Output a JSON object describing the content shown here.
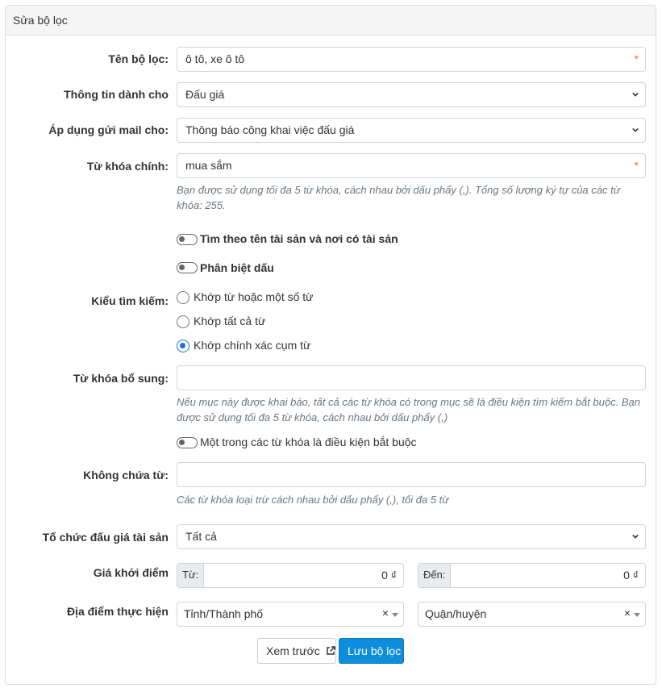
{
  "panel": {
    "title": "Sửa bộ lọc"
  },
  "fields": {
    "filter_name": {
      "label": "Tên bộ lọc:",
      "value": "ô tô, xe ô tô",
      "required": "*"
    },
    "info_for": {
      "label": "Thông tin dành cho",
      "value": "Đấu giá"
    },
    "mail_apply": {
      "label": "Áp dụng gửi mail cho:",
      "value": "Thông báo công khai việc đấu giá"
    },
    "main_keyword": {
      "label": "Từ khóa chính:",
      "value": "mua sắm",
      "required": "*",
      "help": "Bạn được sử dụng tối đa 5 từ khóa, cách nhau bởi dấu phẩy (,). Tổng số lượng ký tự của các từ khóa: 255."
    },
    "toggle_name_place": {
      "label": "Tìm theo tên tài sản và nơi có tài sản",
      "checked": false
    },
    "toggle_accent": {
      "label": "Phân biệt dấu",
      "checked": false
    },
    "search_type": {
      "label": "Kiểu tìm kiếm:",
      "options": [
        "Khớp từ hoặc một số từ",
        "Khớp tất cả từ",
        "Khớp chính xác cụm từ"
      ],
      "selected": "Khớp chính xác cụm từ"
    },
    "extra_keyword": {
      "label": "Từ khóa bổ sung:",
      "value": "",
      "help": "Nếu mục này được khai báo, tất cả các từ khóa có trong mục sẽ là điều kiện tìm kiếm bắt buộc. Bạn được sử dụng tối đa 5 từ khóa, cách nhau bởi dấu phẩy (,)",
      "toggle_label": "Một trong các từ khóa là điều kiện bắt buộc",
      "toggle_checked": false
    },
    "exclude": {
      "label": "Không chứa từ:",
      "value": "",
      "help": "Các từ khóa loại trừ cách nhau bởi dấu phẩy (,), tối đa 5 từ"
    },
    "organizer": {
      "label": "Tổ chức đấu giá tài sản",
      "value": "Tất cả"
    },
    "start_price": {
      "label": "Giá khởi điểm",
      "from_label": "Từ:",
      "from_value": "0 ₫",
      "to_label": "Đến:",
      "to_value": "0 ₫"
    },
    "location": {
      "label": "Địa điểm thực hiện",
      "province": "Tỉnh/Thành phố",
      "district": "Quận/huyện",
      "clear": "×"
    }
  },
  "buttons": {
    "preview": "Xem trước",
    "save": "Lưu bộ lọc"
  },
  "icons": {
    "preview": "external-link-icon",
    "select": "chevron-down-icon",
    "select2_caret": "caret-down-icon"
  },
  "colors": {
    "primary": "#0d8ddb",
    "required": "#f0721e",
    "radio_active": "#1a73e8"
  }
}
